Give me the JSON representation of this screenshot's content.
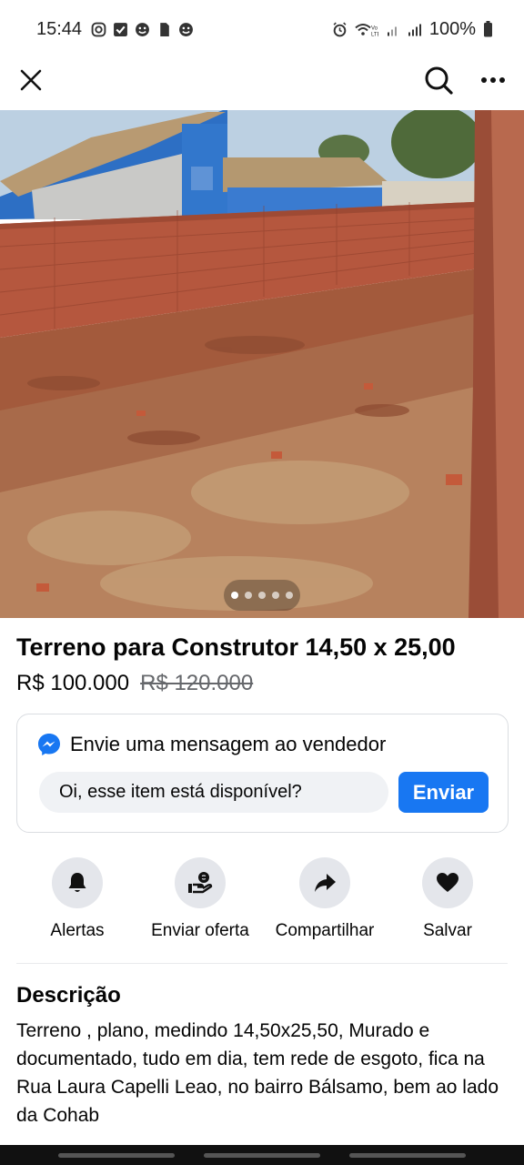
{
  "status_bar": {
    "time": "15:44",
    "battery": "100%"
  },
  "top_bar": {
    "close_icon": "close-icon",
    "search_icon": "search-icon",
    "more_icon": "more-icon"
  },
  "photo": {
    "image_count": 5,
    "active_index": 0
  },
  "listing": {
    "title": "Terreno para Construtor 14,50 x 25,00",
    "price": "R$ 100.000",
    "old_price": "R$ 120.000"
  },
  "message": {
    "title": "Envie uma mensagem ao vendedor",
    "input_value": "Oi, esse item está disponível?",
    "send_label": "Enviar",
    "accent": "#1877f2"
  },
  "actions": [
    {
      "label": "Alertas",
      "icon": "bell-icon"
    },
    {
      "label": "Enviar oferta",
      "icon": "offer-icon"
    },
    {
      "label": "Compartilhar",
      "icon": "share-icon"
    },
    {
      "label": "Salvar",
      "icon": "heart-icon"
    }
  ],
  "description": {
    "heading": "Descrição",
    "text": "Terreno , plano, medindo 14,50x25,50, Murado e documentado, tudo em dia, tem rede de esgoto, fica na Rua Laura Capelli Leao, no bairro Bálsamo, bem ao lado da Cohab"
  }
}
